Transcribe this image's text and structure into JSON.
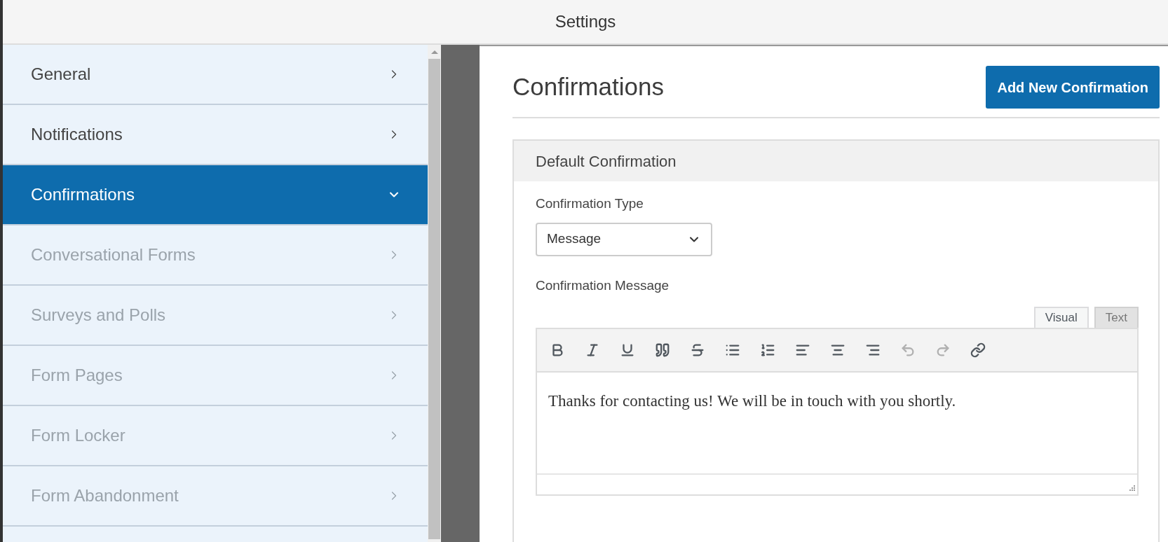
{
  "window": {
    "title": "Settings"
  },
  "sidebar": {
    "items": [
      {
        "label": "General",
        "selected": false,
        "disabled": false
      },
      {
        "label": "Notifications",
        "selected": false,
        "disabled": false
      },
      {
        "label": "Confirmations",
        "selected": true,
        "disabled": false
      },
      {
        "label": "Conversational Forms",
        "selected": false,
        "disabled": true
      },
      {
        "label": "Surveys and Polls",
        "selected": false,
        "disabled": true
      },
      {
        "label": "Form Pages",
        "selected": false,
        "disabled": true
      },
      {
        "label": "Form Locker",
        "selected": false,
        "disabled": true
      },
      {
        "label": "Form Abandonment",
        "selected": false,
        "disabled": true
      }
    ]
  },
  "content": {
    "title": "Confirmations",
    "add_button": "Add New Confirmation",
    "panel": {
      "title": "Default Confirmation",
      "type_label": "Confirmation Type",
      "type_value": "Message",
      "message_label": "Confirmation Message",
      "editor_tabs": [
        {
          "label": "Visual",
          "selected": true
        },
        {
          "label": "Text",
          "selected": false
        }
      ],
      "toolbar": [
        {
          "kind": "bold",
          "disabled": false
        },
        {
          "kind": "italic",
          "disabled": false
        },
        {
          "kind": "underline",
          "disabled": false
        },
        {
          "kind": "quote",
          "disabled": false
        },
        {
          "kind": "strikethrough",
          "disabled": false
        },
        {
          "kind": "bullet-list",
          "disabled": false
        },
        {
          "kind": "numbered-list",
          "disabled": false
        },
        {
          "kind": "align-left",
          "disabled": false
        },
        {
          "kind": "align-center",
          "disabled": false
        },
        {
          "kind": "align-right",
          "disabled": false
        },
        {
          "kind": "undo",
          "disabled": true
        },
        {
          "kind": "redo",
          "disabled": true
        },
        {
          "kind": "link",
          "disabled": false
        }
      ],
      "message": "Thanks for contacting us! We will be in touch with you shortly."
    }
  }
}
